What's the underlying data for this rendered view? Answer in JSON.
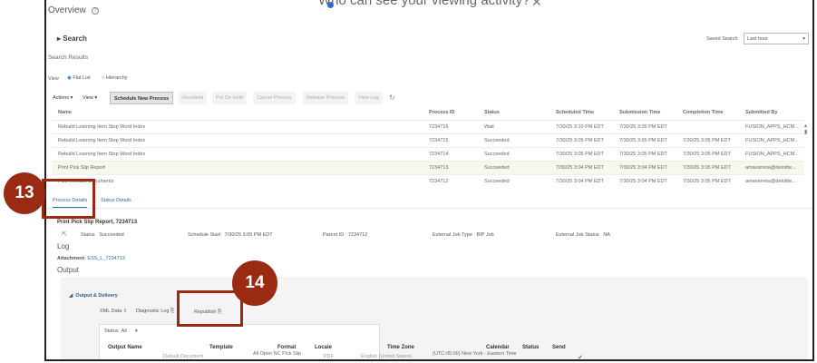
{
  "overlay": {
    "popup_text": "Who can see your viewing activity?",
    "close": "✕"
  },
  "header": {
    "title": "Overview",
    "help": "?"
  },
  "search": {
    "label": "Search",
    "saved_search_label": "Saved Search",
    "saved_search_value": "Last hour"
  },
  "results": {
    "title": "Search Results",
    "view_label": "View",
    "view_options": [
      "Flat List",
      "Hierarchy"
    ],
    "selected_view": "Flat List"
  },
  "toolbar": {
    "actions": "Actions ▾",
    "view": "View ▾",
    "buttons": [
      "Schedule New Process",
      "Resubmit",
      "Put On Hold",
      "Cancel Process",
      "Release Process",
      "View Log"
    ]
  },
  "table": {
    "columns": [
      "Name",
      "Process ID",
      "Status",
      "Scheduled Time",
      "Submission Time",
      "Completion Time",
      "Submitted By"
    ],
    "rows": [
      [
        "Rebuild Learning Item Stop Word Index",
        "7234716",
        "Wait",
        "7/30/25 3:10 PM EDT",
        "7/30/25 3:05 PM EDT",
        "",
        "FUSION_APPS_HCM..."
      ],
      [
        "Rebuild Learning Item Stop Word Index",
        "7234715",
        "Succeeded",
        "7/30/25 3:05 PM EDT",
        "7/30/25 3:05 PM EDT",
        "7/30/25 3:05 PM EDT",
        "FUSION_APPS_HCM..."
      ],
      [
        "Rebuild Learning Item Stop Word Index",
        "7234714",
        "Succeeded",
        "7/30/25 3:05 PM EDT",
        "7/30/25 3:05 PM EDT",
        "7/30/25 3:05 PM EDT",
        "FUSION_APPS_HCM..."
      ],
      [
        "Print Pick Slip Report",
        "7234713",
        "Succeeded",
        "7/30/25 3:04 PM EDT",
        "7/30/25 3:04 PM EDT",
        "7/30/25 3:05 PM EDT",
        "amavarreta@deloitte..."
      ],
      [
        "Pick Release Documents",
        "7234712",
        "Succeeded",
        "7/30/25 3:04 PM EDT",
        "7/30/25 3:04 PM EDT",
        "7/30/25 3:05 PM EDT",
        "amavarreta@deloitte..."
      ]
    ]
  },
  "tabs": [
    "Process Details",
    "Status Details"
  ],
  "details": {
    "title": "Print Pick Slip Report, 7234713",
    "status_label": "Status",
    "status": "Succeeded",
    "schedule_start_label": "Schedule Start",
    "schedule_start": "7/30/25 3:05 PM EDT",
    "parent_id_label": "Parent ID",
    "parent_id": "7234712",
    "ext_type_label": "External Job Type",
    "ext_type": "BIP Job",
    "ext_status_label": "External Job Status",
    "ext_status": "NA"
  },
  "log": {
    "title": "Log",
    "attachment_label": "Attachment",
    "attachment": "ESS_L_7234713"
  },
  "output": {
    "title": "Output",
    "section": "Output & Delivery",
    "xml": "XML Data",
    "diag": "Diagnostic Log",
    "republish": "Republish",
    "status_label": "Status",
    "status_value": "All",
    "columns": [
      "Output Name",
      "Template",
      "Format",
      "Locale",
      "Time Zone",
      "Calendar",
      "Status",
      "Send"
    ],
    "row": [
      "Default Document",
      "All Open NC Pick Slip",
      "PDF",
      "English (United States)",
      "(UTC-05:00) New York - Eastern Time"
    ]
  },
  "annotations": {
    "step13": "13",
    "step14": "14"
  }
}
